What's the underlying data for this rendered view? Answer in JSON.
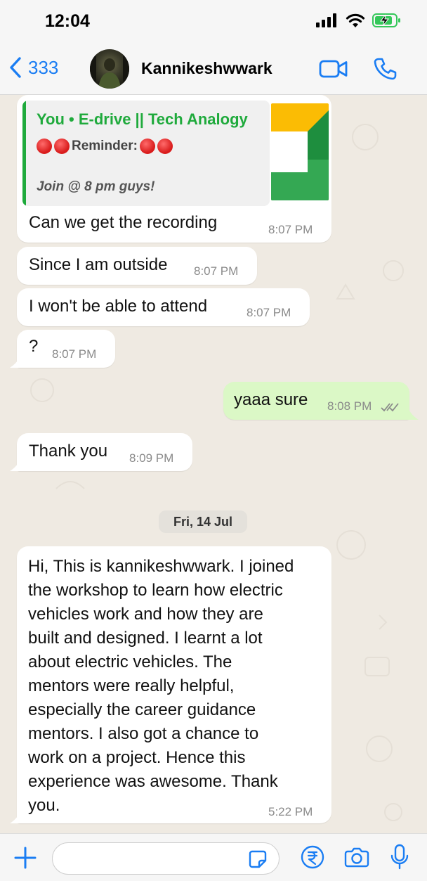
{
  "status": {
    "time": "12:04"
  },
  "header": {
    "back_count": "333",
    "contact_name": "Kannikeshwwark",
    "accent": "#1a7df3"
  },
  "messages": [
    {
      "direction": "in",
      "reply_to": {
        "author": "You • E-drive || Tech Analogy",
        "line2": "Reminder:",
        "line3": "Join @ 8 pm guys!"
      },
      "text": "Can we get the recording",
      "time": "8:07 PM"
    },
    {
      "direction": "in",
      "text": "Since I am outside",
      "time": "8:07 PM"
    },
    {
      "direction": "in",
      "text": "I won't be able to attend",
      "time": "8:07 PM"
    },
    {
      "direction": "in",
      "text": "?",
      "time": "8:07 PM"
    },
    {
      "direction": "out",
      "text": "yaaa sure",
      "time": "8:08 PM",
      "status": "read"
    },
    {
      "direction": "in",
      "text": "Thank you",
      "time": "8:09 PM"
    }
  ],
  "date_divider": "Fri, 14 Jul",
  "long_message": {
    "lines": [
      "Hi, This is kannikeshwwark. I joined",
      "the workshop to learn how electric",
      "vehicles work and how they are",
      "built and designed. I learnt a lot",
      "about electric vehicles. The",
      "mentors were really helpful,",
      "especially the career guidance",
      "mentors. I also got a chance to",
      "work on a project. Hence this",
      "experience was awesome. Thank",
      "you."
    ],
    "time": "5:22 PM"
  },
  "composer": {
    "input_value": "",
    "icons": [
      "plus-icon",
      "sticker-icon",
      "rupee-payment-icon",
      "camera-icon",
      "microphone-icon"
    ]
  },
  "colors": {
    "incoming_bubble": "#ffffff",
    "outgoing_bubble": "#dbf8c6",
    "reply_green": "#1faa3c",
    "chat_background": "#efeae2"
  }
}
